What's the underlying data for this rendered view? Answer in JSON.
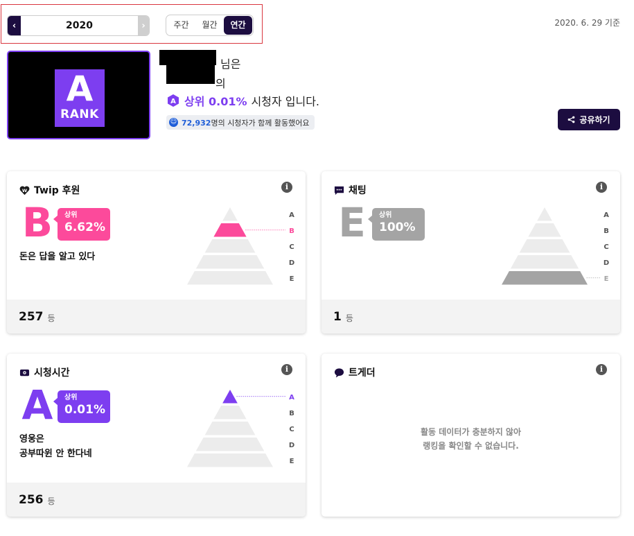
{
  "period": {
    "year": "2020",
    "tabs": [
      "주간",
      "월간",
      "연간"
    ],
    "active_tab": "연간",
    "as_of": "2020. 6. 29 기준"
  },
  "profile": {
    "rank_letter": "A",
    "rank_word": "RANK",
    "suffix_line1": "님은",
    "suffix_line2": "의",
    "top_prefix": "상위 0.01%",
    "top_suffix": "시청자 입니다.",
    "viewer_count": "72,932",
    "viewer_text": "명의 시청자가 함께 활동했어요",
    "share_label": "공유하기"
  },
  "grades": [
    "A",
    "B",
    "C",
    "D",
    "E"
  ],
  "cards": {
    "twip": {
      "title": "Twip 후원",
      "grade": "B",
      "pct_label": "상위",
      "pct_value": "6.62%",
      "desc1": "돈은 답을 알고 있다",
      "desc2": "",
      "rank": "257",
      "rank_unit": "등",
      "color": "#fc4a9b"
    },
    "chat": {
      "title": "채팅",
      "grade": "E",
      "pct_label": "상위",
      "pct_value": "100%",
      "desc1": "",
      "desc2": "",
      "rank": "1",
      "rank_unit": "등",
      "color": "#a4a4a4"
    },
    "watch": {
      "title": "시청시간",
      "grade": "A",
      "pct_label": "상위",
      "pct_value": "0.01%",
      "desc1": "영웅은",
      "desc2": "공부따윈 안 한다네",
      "rank": "256",
      "rank_unit": "등",
      "color": "#7d3ef0"
    },
    "tgd": {
      "title": "트게더",
      "nodata1": "활동 데이터가 충분하지 않아",
      "nodata2": "랭킹을 확인할 수 없습니다."
    }
  }
}
